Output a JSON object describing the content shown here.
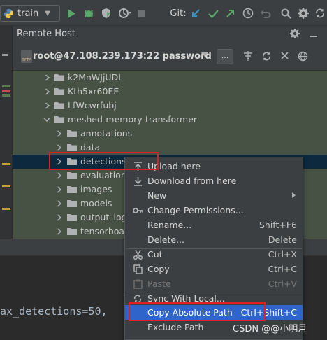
{
  "toolbar": {
    "run_config": "train",
    "git_label": "Git:",
    "icons": [
      "python-icon",
      "run-icon",
      "debug-icon",
      "coverage-icon",
      "profile-icon",
      "stop-icon",
      "vcs-update-icon",
      "vcs-commit-icon",
      "vcs-push-icon",
      "history-icon",
      "rollback-icon",
      "search-icon",
      "settings-icon",
      "sync-icon"
    ]
  },
  "remote_host": {
    "title": "Remote Host",
    "connection": "root@47.108.239.173:22 password",
    "more_button": "...",
    "sftp_badge": "SFTP"
  },
  "tree": {
    "items": [
      {
        "label": "k2MnWJjUDL",
        "expanded": false
      },
      {
        "label": "Kth5xr60EE",
        "expanded": false
      },
      {
        "label": "LfWcwrfubj",
        "expanded": false
      },
      {
        "label": "meshed-memory-transformer",
        "expanded": true
      },
      {
        "label": "annotations",
        "expanded": false
      },
      {
        "label": "data",
        "expanded": false
      },
      {
        "label": "detections_",
        "expanded": false
      },
      {
        "label": "evaluation",
        "expanded": false
      },
      {
        "label": "images",
        "expanded": false
      },
      {
        "label": "models",
        "expanded": false
      },
      {
        "label": "output_log",
        "expanded": false
      },
      {
        "label": "tensorboa",
        "expanded": false
      }
    ]
  },
  "context_menu": {
    "items": [
      {
        "label": "Upload here",
        "shortcut": "",
        "icon": "upload-icon"
      },
      {
        "label": "Download from here",
        "shortcut": "",
        "icon": "download-icon"
      },
      {
        "label": "New",
        "shortcut": "",
        "icon": ""
      },
      {
        "label": "Change Permissions...",
        "shortcut": "",
        "icon": "key-icon"
      },
      {
        "label": "Rename...",
        "shortcut": "Shift+F6",
        "icon": ""
      },
      {
        "label": "Delete...",
        "shortcut": "Delete",
        "icon": ""
      },
      {
        "label": "Cut",
        "shortcut": "Ctrl+X",
        "icon": "cut-icon"
      },
      {
        "label": "Copy",
        "shortcut": "Ctrl+C",
        "icon": "copy-icon"
      },
      {
        "label": "Paste",
        "shortcut": "Ctrl+V",
        "icon": "paste-icon"
      },
      {
        "label": "Sync With Local...",
        "shortcut": "",
        "icon": "sync-icon"
      },
      {
        "label": "Copy Absolute Path",
        "shortcut": "Ctrl+Shift+C",
        "icon": ""
      },
      {
        "label": "Exclude Path",
        "shortcut": "",
        "icon": ""
      }
    ]
  },
  "editor": {
    "code_line": "ax_detections=50,"
  },
  "watermark": "CSDN @@小明月",
  "colors": {
    "menu_highlight": "#2f65ca",
    "annotation_red": "#e02020",
    "folder": "#afb1b3",
    "run_green": "#59a869"
  }
}
